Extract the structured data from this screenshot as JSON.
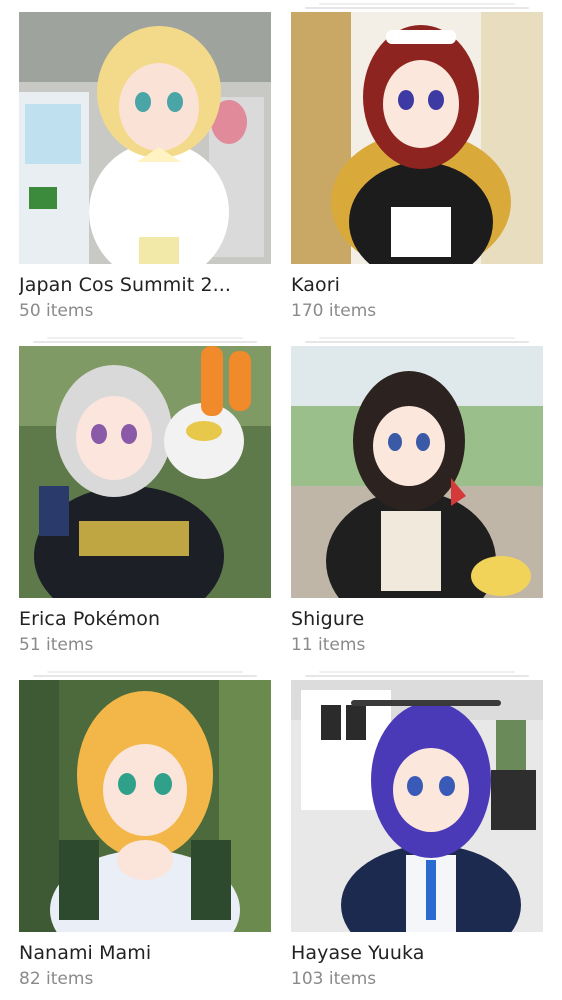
{
  "albums": [
    {
      "title": "Japan Cos Summit 2...",
      "count": "50 items",
      "hair": "#f3d98a",
      "bg": "#c8c9c4",
      "accent": "#fff3c4"
    },
    {
      "title": "Kaori",
      "count": "170 items",
      "hair": "#8e2420",
      "bg": "#e4d2a4",
      "accent": "#1c1c1c"
    },
    {
      "title": "Erica Pokémon",
      "count": "51 items",
      "hair": "#d9d9d9",
      "bg": "#5f7a4a",
      "accent": "#1c1f26"
    },
    {
      "title": "Shigure",
      "count": "11 items",
      "hair": "#2c2320",
      "bg": "#9bbf8a",
      "accent": "#1f1f1f"
    },
    {
      "title": "Nanami Mami",
      "count": "82 items",
      "hair": "#f2b748",
      "bg": "#4c6a3c",
      "accent": "#e9eef7"
    },
    {
      "title": "Hayase Yuuka",
      "count": "103 items",
      "hair": "#4b3ab8",
      "bg": "#e8e8e8",
      "accent": "#1d2a4f"
    }
  ]
}
